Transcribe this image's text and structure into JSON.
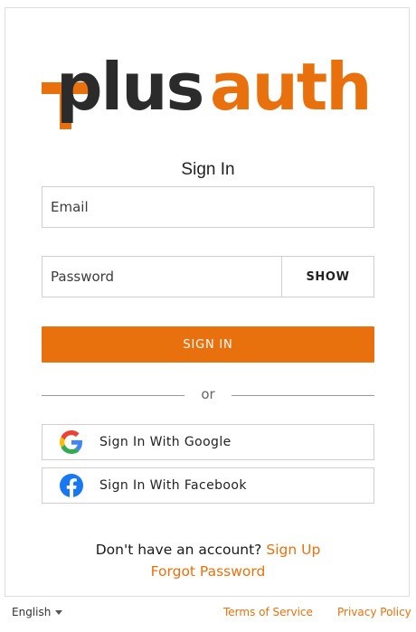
{
  "brand": {
    "logo_text_dark": "plus",
    "logo_text_accent": "auth",
    "accent_color": "#e8700d",
    "dark_color": "#2b2b2b"
  },
  "form": {
    "title": "Sign In",
    "email_placeholder": "Email",
    "password_placeholder": "Password",
    "show_label": "SHOW",
    "submit_label": "SIGN IN",
    "divider_text": "or"
  },
  "social": {
    "google_label": "Sign In With Google",
    "facebook_label": "Sign In With Facebook",
    "google_icon": "google-icon",
    "facebook_icon": "facebook-icon"
  },
  "links": {
    "no_account_text": "Don't have an account?",
    "signup_label": "Sign Up",
    "forgot_label": "Forgot Password"
  },
  "footer": {
    "language": "English",
    "terms_label": "Terms of Service",
    "privacy_label": "Privacy Policy"
  }
}
